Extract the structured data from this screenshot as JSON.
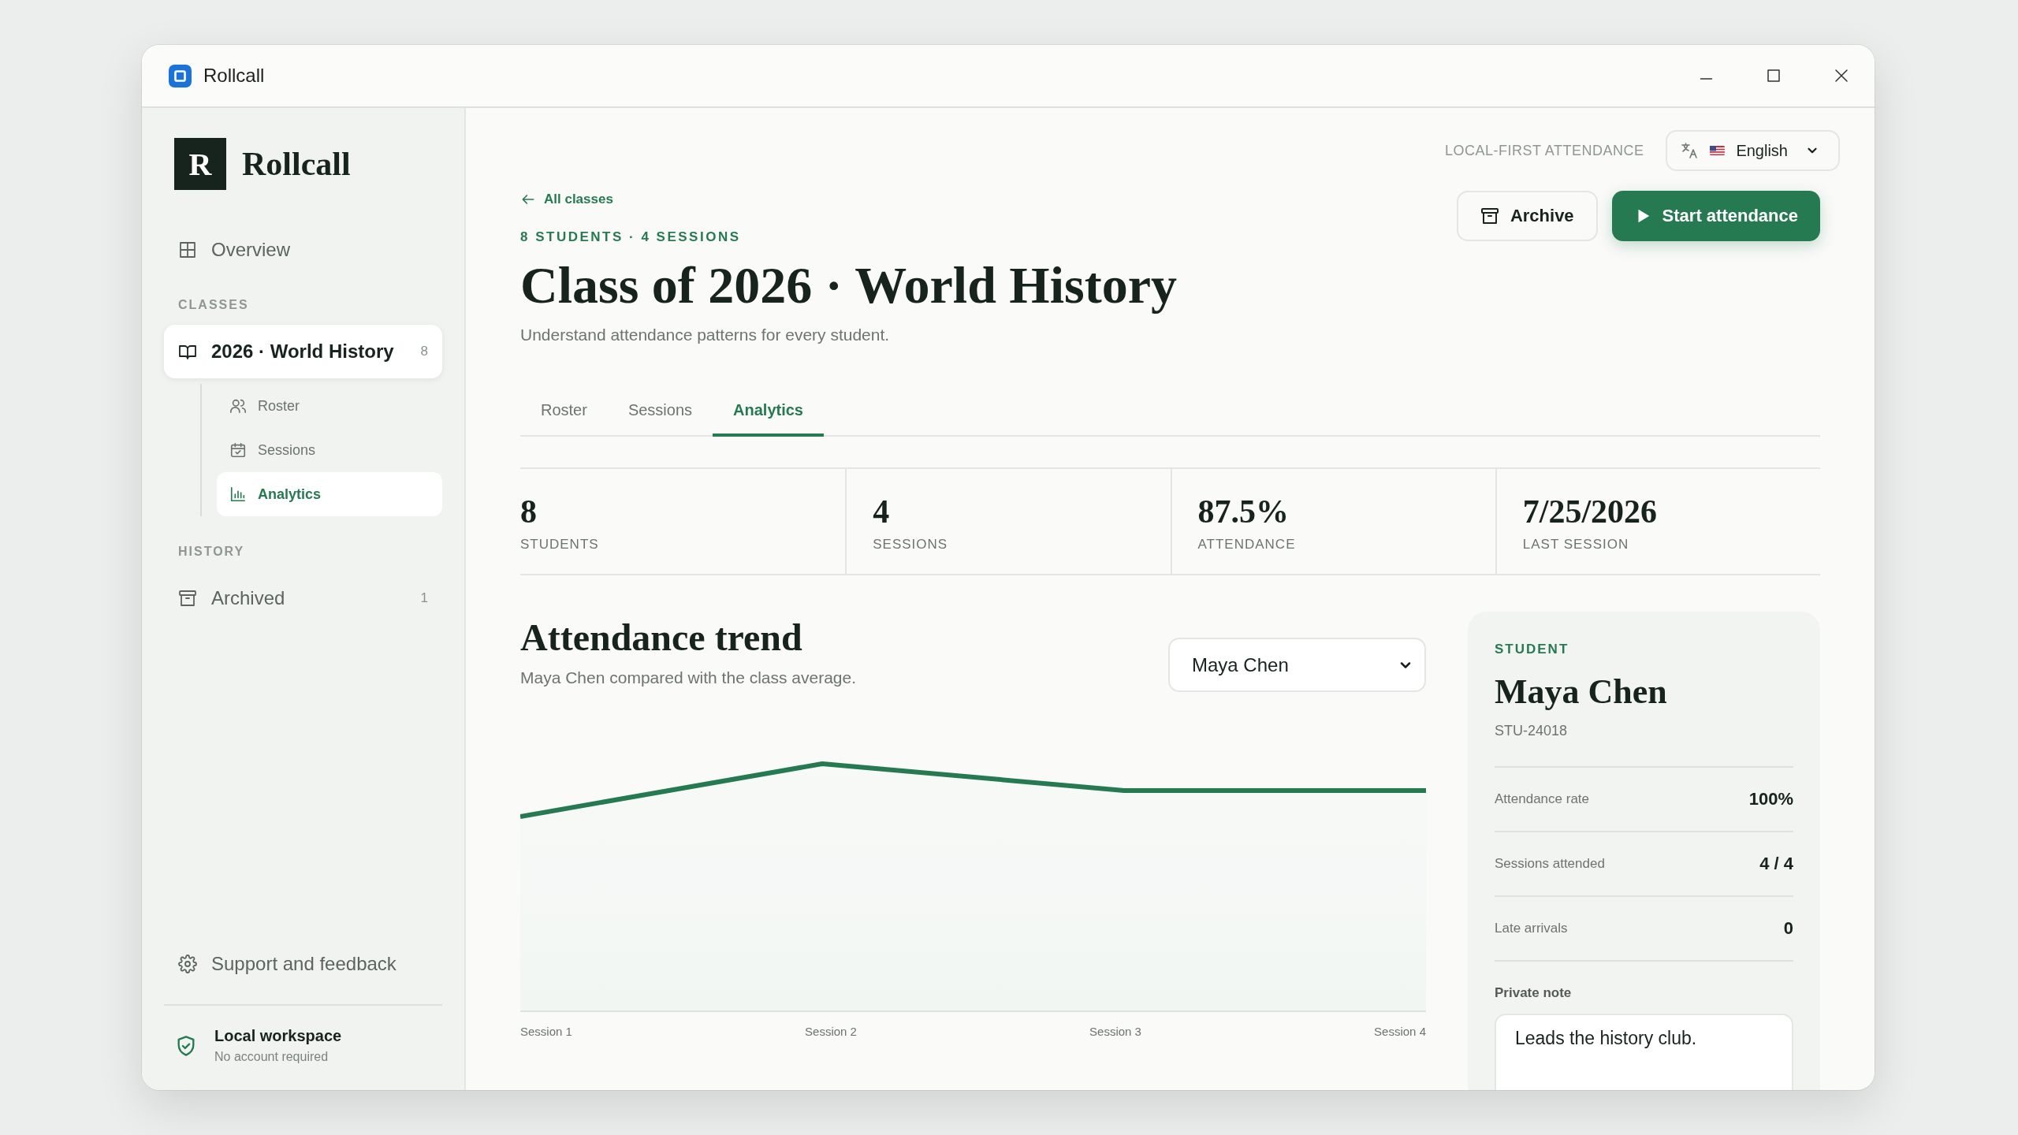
{
  "window": {
    "title": "Rollcall"
  },
  "sidebar": {
    "brand": {
      "mark": "R",
      "name": "Rollcall"
    },
    "nav": [
      {
        "label": "Overview",
        "selected": false
      }
    ],
    "sections": [
      {
        "heading": "CLASSES",
        "items": [
          {
            "label": "2026 · World History",
            "count": "8",
            "selected": true,
            "children": [
              {
                "label": "Roster",
                "selected": false
              },
              {
                "label": "Sessions",
                "selected": false
              },
              {
                "label": "Analytics",
                "selected": true
              }
            ]
          }
        ]
      },
      {
        "heading": "HISTORY",
        "items": [
          {
            "label": "Archived",
            "count": "1",
            "selected": false
          }
        ]
      }
    ],
    "support": "Support and feedback",
    "workspace": {
      "title": "Local workspace",
      "subtitle": "No account required"
    }
  },
  "header": {
    "tagline": "LOCAL-FIRST ATTENDANCE",
    "language": "English",
    "back_link": "All classes",
    "overline": "8 STUDENTS · 4 SESSIONS",
    "title": "Class of 2026 · World History",
    "subtitle": "Understand attendance patterns for every student.",
    "actions": [
      {
        "label": "Archive",
        "kind": "secondary"
      },
      {
        "label": "Start attendance",
        "kind": "primary"
      }
    ]
  },
  "tabs": [
    {
      "label": "Roster",
      "selected": false
    },
    {
      "label": "Sessions",
      "selected": false
    },
    {
      "label": "Analytics",
      "selected": true
    }
  ],
  "stats": [
    {
      "value": "8",
      "label": "STUDENTS"
    },
    {
      "value": "4",
      "label": "SESSIONS"
    },
    {
      "value": "87.5%",
      "label": "ATTENDANCE"
    },
    {
      "value": "7/25/2026",
      "label": "LAST SESSION"
    }
  ],
  "trend": {
    "title": "Attendance trend",
    "subtitle": "Maya Chen compared with the class average.",
    "student_select": "Maya Chen",
    "x_labels": [
      "Session 1",
      "Session 2",
      "Session 3",
      "Session 4"
    ]
  },
  "student": {
    "overline": "STUDENT",
    "name": "Maya Chen",
    "id": "STU-24018",
    "metrics": [
      {
        "label": "Attendance rate",
        "value": "100%"
      },
      {
        "label": "Sessions attended",
        "value": "4 / 4"
      },
      {
        "label": "Late arrivals",
        "value": "0"
      }
    ],
    "note_label": "Private note",
    "note": "Leads the history club."
  }
}
